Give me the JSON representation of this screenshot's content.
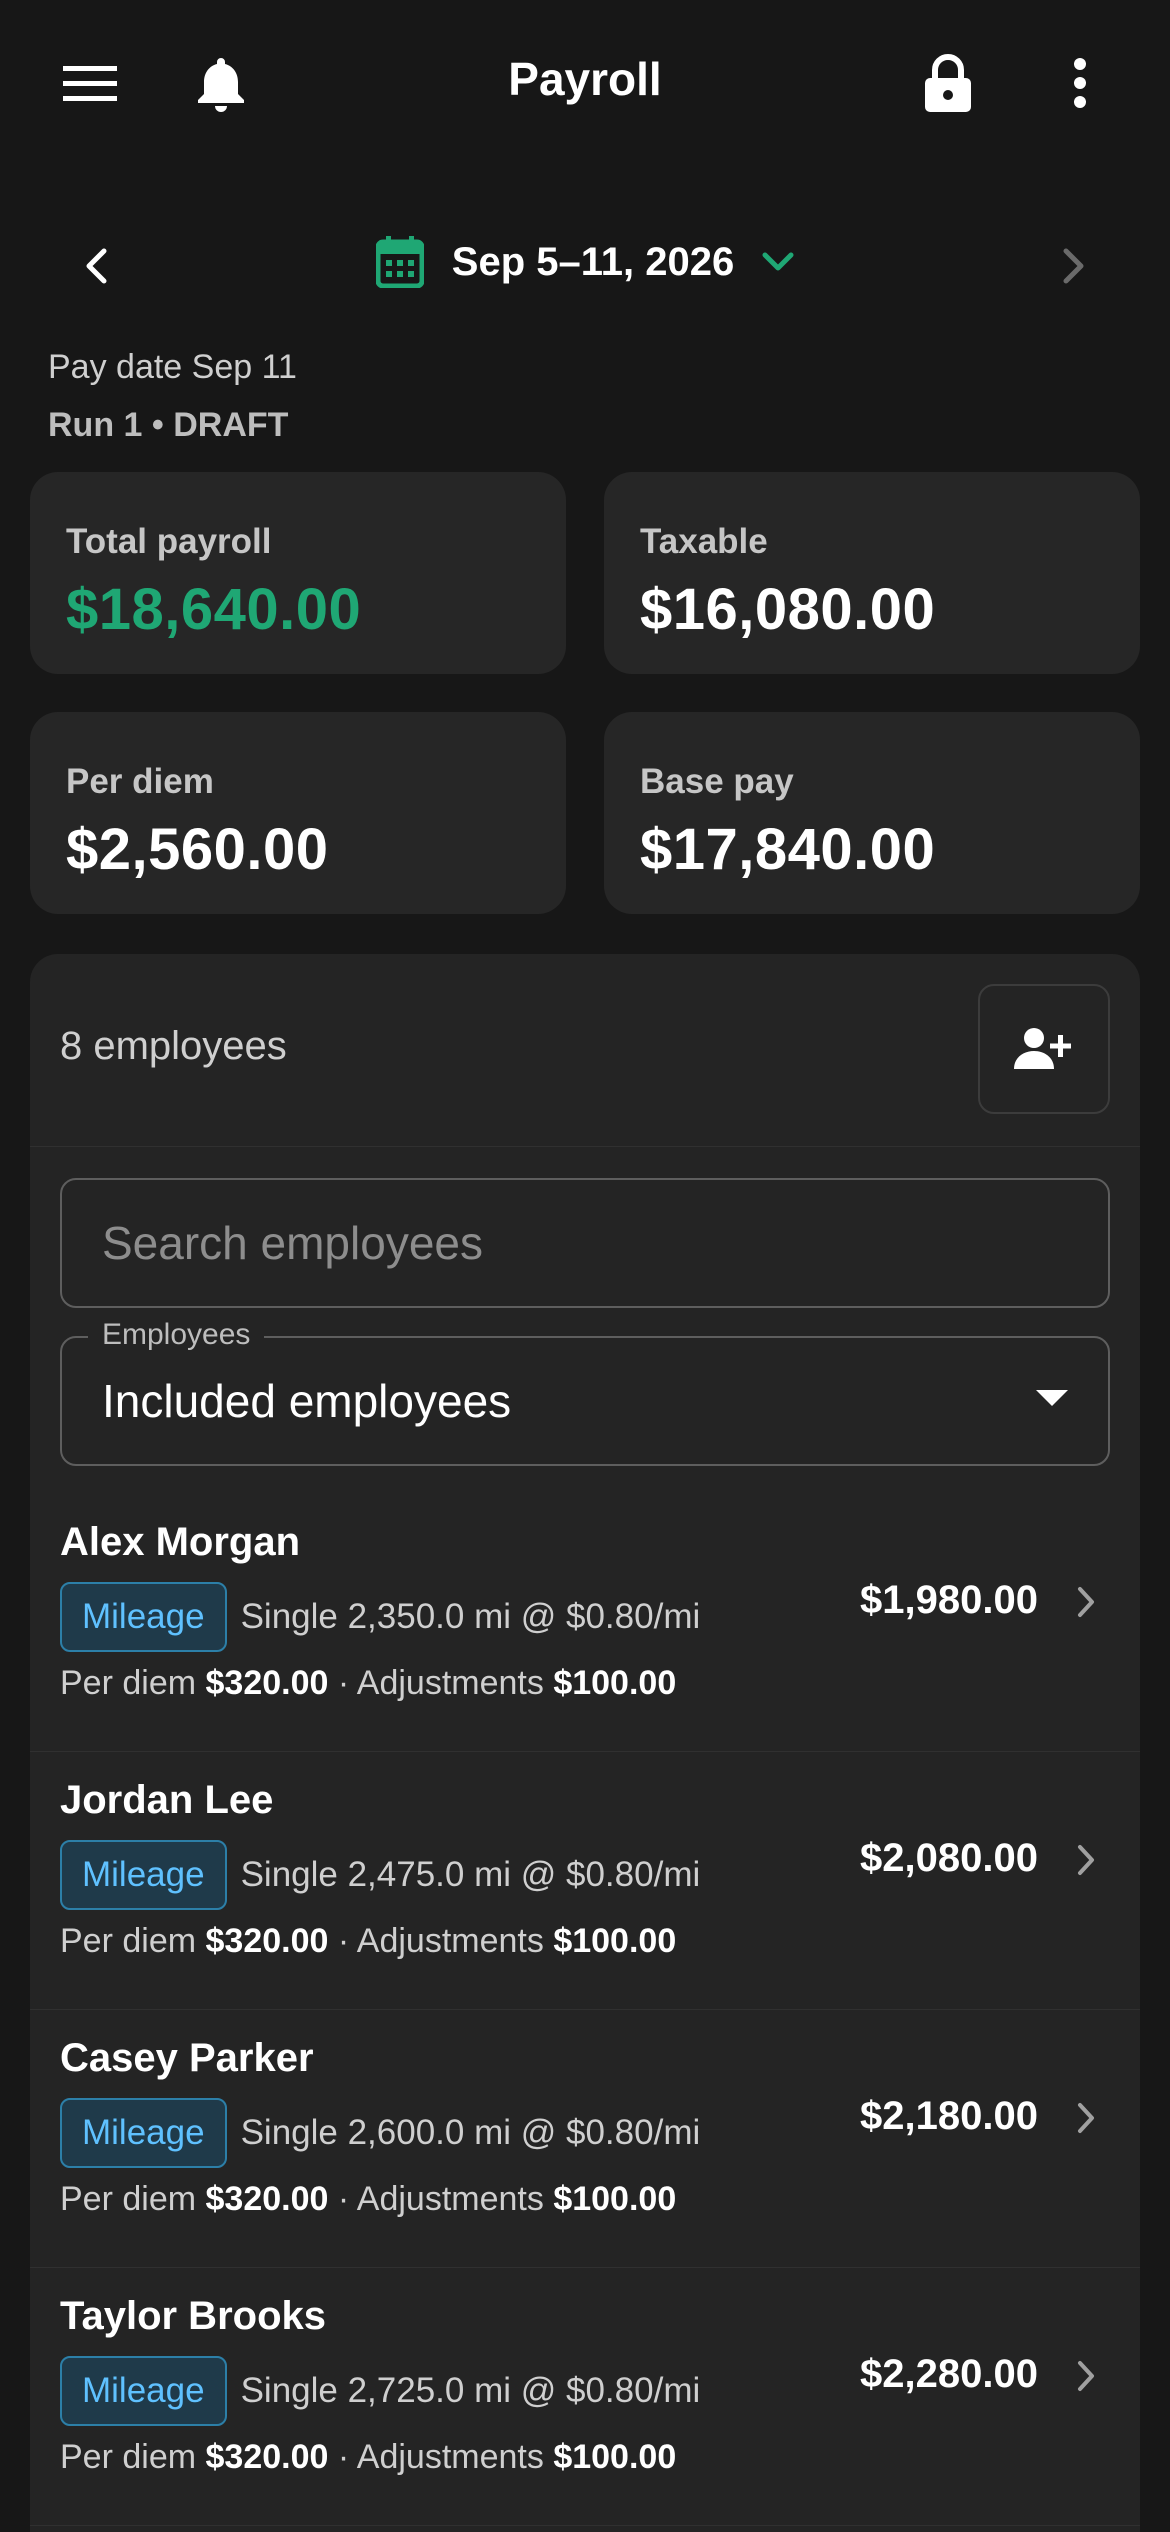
{
  "header": {
    "title": "Payroll",
    "icons": [
      "menu-icon",
      "bell-icon",
      "lock-icon",
      "more-vert-icon"
    ]
  },
  "period": {
    "label": "Sep 5–11, 2026",
    "pay_date": "Pay date Sep 11",
    "run": "Run 1 • DRAFT"
  },
  "summary": {
    "total_payroll_label": "Total payroll",
    "total_payroll_value": "$18,640.00",
    "taxable_label": "Taxable",
    "taxable_value": "$16,080.00",
    "per_diem_label": "Per diem",
    "per_diem_value": "$2,560.00",
    "base_pay_label": "Base pay",
    "base_pay_value": "$17,840.00"
  },
  "employees_panel": {
    "count": "8 employees",
    "search_placeholder": "Search employees",
    "filter_label": "Employees",
    "filter_value": "Included employees"
  },
  "employees": [
    {
      "name": "Alex Morgan",
      "badge": "Mileage",
      "rate": "Single 2,350.0 mi @ $0.80/mi",
      "per_diem_label": "Per diem",
      "per_diem": "$320.00",
      "sep": "·",
      "adj_label": "Adjustments",
      "adjustments": "$100.00",
      "amount": "$1,980.00"
    },
    {
      "name": "Jordan Lee",
      "badge": "Mileage",
      "rate": "Single 2,475.0 mi @ $0.80/mi",
      "per_diem_label": "Per diem",
      "per_diem": "$320.00",
      "sep": "·",
      "adj_label": "Adjustments",
      "adjustments": "$100.00",
      "amount": "$2,080.00"
    },
    {
      "name": "Casey Parker",
      "badge": "Mileage",
      "rate": "Single 2,600.0 mi @ $0.80/mi",
      "per_diem_label": "Per diem",
      "per_diem": "$320.00",
      "sep": "·",
      "adj_label": "Adjustments",
      "adjustments": "$100.00",
      "amount": "$2,180.00"
    },
    {
      "name": "Taylor Brooks",
      "badge": "Mileage",
      "rate": "Single 2,725.0 mi @ $0.80/mi",
      "per_diem_label": "Per diem",
      "per_diem": "$320.00",
      "sep": "·",
      "adj_label": "Adjustments",
      "adjustments": "$100.00",
      "amount": "$2,280.00"
    }
  ],
  "colors": {
    "background": "#171717",
    "card": "#262626",
    "accent_green": "#1fa774",
    "badge_blue": "#5fc1ff"
  }
}
